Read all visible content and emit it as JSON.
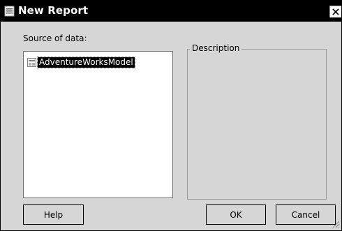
{
  "window": {
    "title": "New Report",
    "close_glyph": "✕"
  },
  "source": {
    "label": "Source of data:",
    "items": [
      {
        "label": "AdventureWorksModel",
        "icon": "data-model-icon",
        "selected": true
      }
    ]
  },
  "description": {
    "legend": "Description",
    "text": ""
  },
  "buttons": {
    "help": "Help",
    "ok": "OK",
    "cancel": "Cancel"
  },
  "colors": {
    "titlebar": "#000000",
    "dialog_bg": "#d6d6d6",
    "selection_bg": "#000000",
    "selection_text": "#ffffff"
  }
}
